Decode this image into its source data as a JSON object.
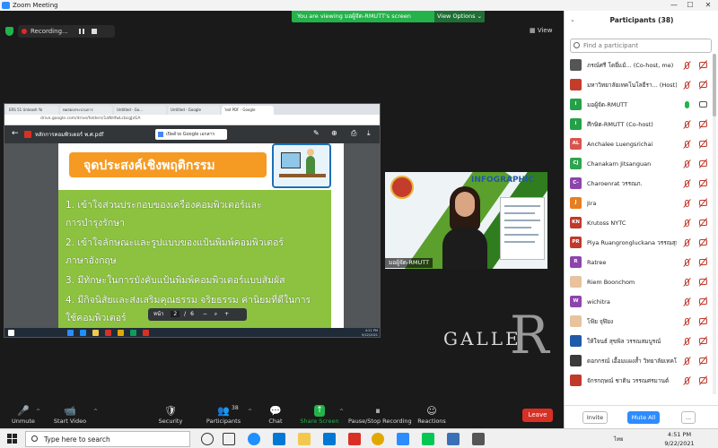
{
  "window": {
    "title": "Zoom Meeting",
    "controls": [
      "—",
      "☐",
      "✕"
    ]
  },
  "meeting": {
    "share_banner": "You are viewing มอผู้จัด-RMUTT's screen",
    "view_options": "View Options ⌄",
    "recording": "Recording...",
    "view_label": "View",
    "gallery_text": "GALLE",
    "gallery_r": "R"
  },
  "shared_screen": {
    "tabs": [
      "ERS 51 Unleash Yo",
      "ทดสอบกระบวนการ",
      "Untitled - Go...",
      "Untitled - Google",
      "ไฟล์ PDF - Google"
    ],
    "url": "drive.google.com/drive/folders/1aNHfwLcbcgJzGA",
    "pdf_title": "หลักการคอมพิวเตอร์ พ.ศ.pdf",
    "open_with": "เปิดด้วย Google เอกสาร",
    "slide_header": "จุดประสงค์เชิงพฤติกรรม",
    "objectives": [
      "1. เข้าใจส่วนประกอบของเครื่องคอมพิวเตอร์และ",
      "   การบำรุงรักษา",
      "2. เข้าใจลักษณะและรูปแบบของแป้นพิมพ์คอมพิวเตอร์",
      "   ภาษาอังกฤษ",
      "3. มีทักษะในการบังคับแป้นพิมพ์คอมพิวเตอร์แบบสัมผัส",
      "4. มีกิจนิสัยและส่งเสริมคุณธรรม จริยธรรม ค่านิยมที่ดีในการ",
      "   ใช้คอมพิวเตอร์"
    ],
    "pager": {
      "label": "หน้า",
      "current": "2",
      "sep": "/",
      "total": "6"
    },
    "mini_time": "4:21 PM",
    "mini_date": "9/22/2021"
  },
  "host_video": {
    "name": "มอผู้จัด-RMUTT",
    "infographic": "INFOGRAPHIC"
  },
  "toolbar": {
    "items": [
      {
        "label": "Unmute",
        "icon": "🎤"
      },
      {
        "label": "Start Video",
        "icon": "📹"
      },
      {
        "label": "Security",
        "icon": "🛡"
      },
      {
        "label": "Participants",
        "icon": "👥",
        "count": "38"
      },
      {
        "label": "Chat",
        "icon": "💬"
      },
      {
        "label": "Share Screen",
        "icon": "↑"
      },
      {
        "label": "Pause/Stop Recording",
        "icon": "⏸"
      },
      {
        "label": "Reactions",
        "icon": "☺"
      }
    ],
    "leave": "Leave"
  },
  "participants": {
    "title": "Participants (38)",
    "search_placeholder": "Find a participant",
    "rows": [
      {
        "name": "ภรณ์ศรี โดยี่แม้... (Co-host, me)",
        "initials": "",
        "color": "#555555",
        "mic": "muted",
        "cam": "off"
      },
      {
        "name": "มหาวิทยาลัยเทคโนโลยีรา... (Host)",
        "initials": "",
        "color": "#c43c2b",
        "mic": "muted",
        "cam": "off"
      },
      {
        "name": "มอผู้จัด-RMUTT",
        "initials": "i",
        "color": "#24a148",
        "mic": "on",
        "cam": "on"
      },
      {
        "name": "ศึกษิต-RMUTT (Co-host)",
        "initials": "i",
        "color": "#24a148",
        "mic": "muted",
        "cam": "off"
      },
      {
        "name": "Anchalee Luengsrichai",
        "initials": "AL",
        "color": "#d9534f",
        "mic": "muted",
        "cam": "off"
      },
      {
        "name": "Chanakarn Jitsanguan",
        "initials": "CJ",
        "color": "#2ea44f",
        "mic": "muted",
        "cam": "off"
      },
      {
        "name": "Charoenrat วรรณภ.",
        "initials": "C-",
        "color": "#8e44ad",
        "mic": "muted",
        "cam": "off"
      },
      {
        "name": "Jira",
        "initials": "J",
        "color": "#e67e22",
        "mic": "muted",
        "cam": "off"
      },
      {
        "name": "Krutoss NYTC",
        "initials": "KN",
        "color": "#c0392b",
        "mic": "muted",
        "cam": "off"
      },
      {
        "name": "Piya Ruangrongluckana วรรณสุมาลา",
        "initials": "PR",
        "color": "#c0392b",
        "mic": "muted",
        "cam": "off"
      },
      {
        "name": "Ratree",
        "initials": "R",
        "color": "#8e44ad",
        "mic": "muted",
        "cam": "off"
      },
      {
        "name": "Riem Boonchom",
        "initials": "",
        "color": "#e8c39e",
        "mic": "muted",
        "cam": "off"
      },
      {
        "name": "wichitra",
        "initials": "W",
        "color": "#8e44ad",
        "mic": "muted",
        "cam": "off"
      },
      {
        "name": "โฟ้ย จุฬิยง",
        "initials": "",
        "color": "#e8c39e",
        "mic": "muted",
        "cam": "off"
      },
      {
        "name": "ให้ใจนธ์ สุขพิล วรรณสมบูรณ์",
        "initials": "",
        "color": "#1e5aa8",
        "mic": "muted",
        "cam": "off"
      },
      {
        "name": "ดอกกรณ์ เอื้อมแผงส้ำ วิทยาลัยเทคโน...",
        "initials": "",
        "color": "#3a3a3a",
        "mic": "muted",
        "cam": "off"
      },
      {
        "name": "จักรกฤษณ์ ชาติน วรรณศรมานต์",
        "initials": "",
        "color": "#c0392b",
        "mic": "muted",
        "cam": "off"
      }
    ],
    "footer": {
      "invite": "Invite",
      "mute_all": "Mute All",
      "more": "..."
    }
  },
  "taskbar": {
    "search_placeholder": "Type here to search",
    "tray": "ไทย",
    "time": "4:51 PM",
    "date": "9/22/2021"
  },
  "colors": {
    "zoom_blue": "#2d8cff",
    "share_green": "#24b24b",
    "leave_red": "#d93025",
    "slide_orange": "#f59a23",
    "slide_green": "#8cc23f"
  }
}
